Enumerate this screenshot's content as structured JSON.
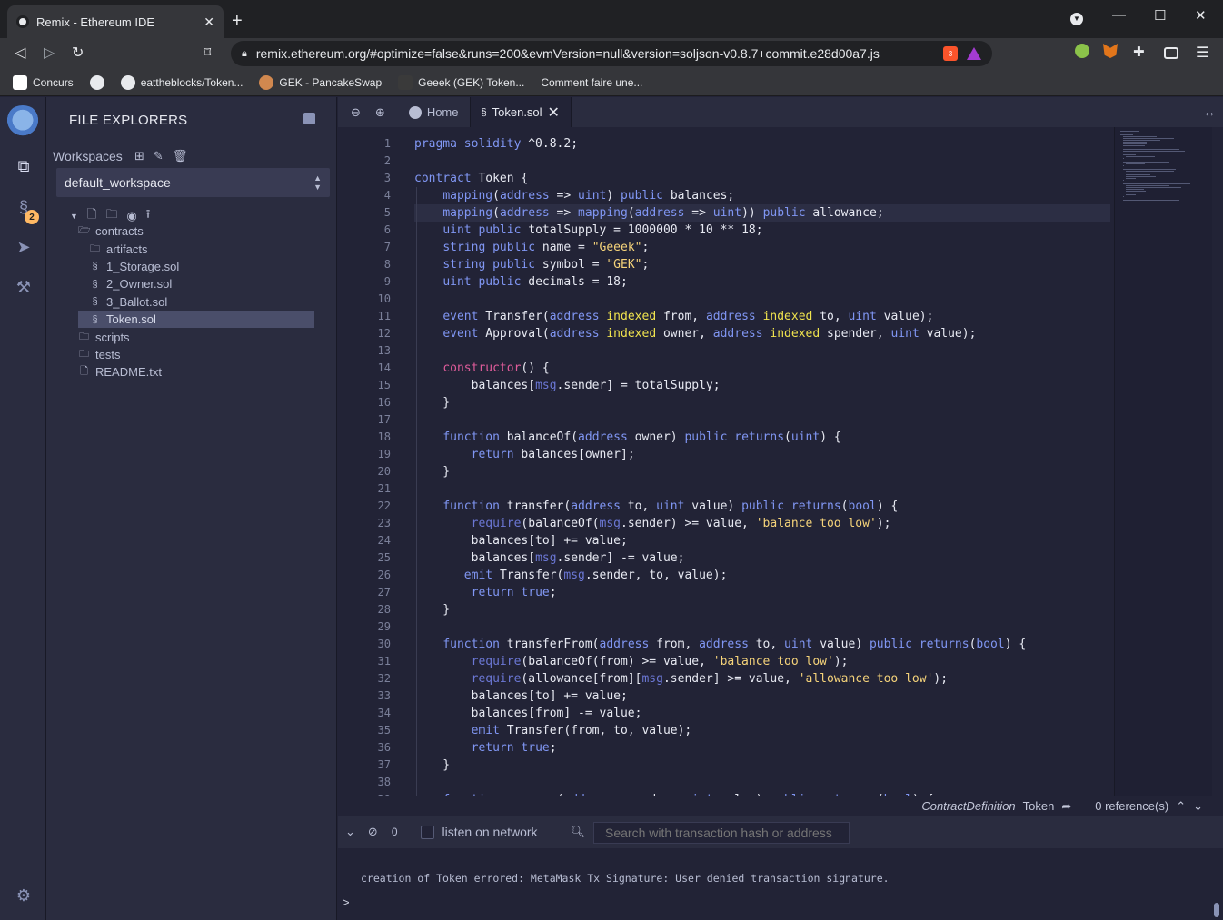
{
  "browser": {
    "tab_title": "Remix - Ethereum IDE",
    "url": "remix.ethereum.org/#optimize=false&runs=200&evmVersion=null&version=soljson-v0.8.7+commit.e28d00a7.js",
    "brave_count": "3",
    "bookmarks": [
      {
        "label": "Concurs"
      },
      {
        "label": ""
      },
      {
        "label": "eattheblocks/Token..."
      },
      {
        "label": "GEK - PancakeSwap"
      },
      {
        "label": "Geeek (GEK) Token..."
      },
      {
        "label": "Comment faire une..."
      }
    ]
  },
  "sidebar": {
    "badge_count": "2"
  },
  "file_explorer": {
    "title": "FILE EXPLORERS",
    "workspaces_label": "Workspaces",
    "workspace_selected": "default_workspace",
    "tree": [
      {
        "name": "contracts",
        "type": "folder-open",
        "depth": 0
      },
      {
        "name": "artifacts",
        "type": "folder",
        "depth": 1
      },
      {
        "name": "1_Storage.sol",
        "type": "sol",
        "depth": 1
      },
      {
        "name": "2_Owner.sol",
        "type": "sol",
        "depth": 1
      },
      {
        "name": "3_Ballot.sol",
        "type": "sol",
        "depth": 1
      },
      {
        "name": "Token.sol",
        "type": "sol",
        "depth": 1,
        "selected": true
      },
      {
        "name": "scripts",
        "type": "folder",
        "depth": 0
      },
      {
        "name": "tests",
        "type": "folder",
        "depth": 0
      },
      {
        "name": "README.txt",
        "type": "file",
        "depth": 0
      }
    ]
  },
  "editor": {
    "tabs": [
      {
        "label": "Home"
      },
      {
        "label": "Token.sol",
        "active": true
      }
    ],
    "code": [
      [
        [
          "k",
          "pragma solidity "
        ],
        [
          "n",
          "^0.8.2;"
        ]
      ],
      [],
      [
        [
          "k",
          "contract "
        ],
        [
          "n",
          "Token {"
        ]
      ],
      [
        [
          "n",
          "    "
        ],
        [
          "t",
          "mapping"
        ],
        [
          "n",
          "("
        ],
        [
          "t",
          "address"
        ],
        [
          "n",
          " => "
        ],
        [
          "t",
          "uint"
        ],
        [
          "n",
          ") "
        ],
        [
          "k",
          "public "
        ],
        [
          "n",
          "balances;"
        ]
      ],
      [
        [
          "n",
          "    "
        ],
        [
          "t",
          "mapping"
        ],
        [
          "n",
          "("
        ],
        [
          "t",
          "address"
        ],
        [
          "n",
          " => "
        ],
        [
          "t",
          "mapping"
        ],
        [
          "n",
          "("
        ],
        [
          "t",
          "address"
        ],
        [
          "n",
          " => "
        ],
        [
          "t",
          "uint"
        ],
        [
          "n",
          ")) "
        ],
        [
          "k",
          "public "
        ],
        [
          "n",
          "allowance;"
        ]
      ],
      [
        [
          "n",
          "    "
        ],
        [
          "t",
          "uint "
        ],
        [
          "k",
          "public "
        ],
        [
          "n",
          "totalSupply = "
        ],
        [
          "n",
          "1000000"
        ],
        [
          "n",
          " * "
        ],
        [
          "n",
          "10"
        ],
        [
          "n",
          " ** "
        ],
        [
          "n",
          "18;"
        ]
      ],
      [
        [
          "n",
          "    "
        ],
        [
          "t",
          "string "
        ],
        [
          "k",
          "public "
        ],
        [
          "n",
          "name = "
        ],
        [
          "s",
          "\"Geeek\""
        ],
        [
          "n",
          ";"
        ]
      ],
      [
        [
          "n",
          "    "
        ],
        [
          "t",
          "string "
        ],
        [
          "k",
          "public "
        ],
        [
          "n",
          "symbol = "
        ],
        [
          "s",
          "\"GEK\""
        ],
        [
          "n",
          ";"
        ]
      ],
      [
        [
          "n",
          "    "
        ],
        [
          "t",
          "uint "
        ],
        [
          "k",
          "public "
        ],
        [
          "n",
          "decimals = 18;"
        ]
      ],
      [],
      [
        [
          "n",
          "    "
        ],
        [
          "k",
          "event "
        ],
        [
          "n",
          "Transfer("
        ],
        [
          "t",
          "address "
        ],
        [
          "y",
          "indexed "
        ],
        [
          "n",
          "from, "
        ],
        [
          "t",
          "address "
        ],
        [
          "y",
          "indexed "
        ],
        [
          "n",
          "to, "
        ],
        [
          "t",
          "uint "
        ],
        [
          "n",
          "value);"
        ]
      ],
      [
        [
          "n",
          "    "
        ],
        [
          "k",
          "event "
        ],
        [
          "n",
          "Approval("
        ],
        [
          "t",
          "address "
        ],
        [
          "y",
          "indexed "
        ],
        [
          "n",
          "owner, "
        ],
        [
          "t",
          "address "
        ],
        [
          "y",
          "indexed "
        ],
        [
          "n",
          "spender, "
        ],
        [
          "t",
          "uint "
        ],
        [
          "n",
          "value);"
        ]
      ],
      [],
      [
        [
          "n",
          "    "
        ],
        [
          "p",
          "constructor"
        ],
        [
          "n",
          "() {"
        ]
      ],
      [
        [
          "n",
          "        balances["
        ],
        [
          "m",
          "msg"
        ],
        [
          "n",
          ".sender] = totalSupply;"
        ]
      ],
      [
        [
          "n",
          "    }"
        ]
      ],
      [],
      [
        [
          "n",
          "    "
        ],
        [
          "k",
          "function "
        ],
        [
          "n",
          "balanceOf("
        ],
        [
          "t",
          "address "
        ],
        [
          "n",
          "owner) "
        ],
        [
          "k",
          "public returns"
        ],
        [
          "n",
          "("
        ],
        [
          "t",
          "uint"
        ],
        [
          "n",
          ") {"
        ]
      ],
      [
        [
          "n",
          "        "
        ],
        [
          "k",
          "return "
        ],
        [
          "n",
          "balances[owner];"
        ]
      ],
      [
        [
          "n",
          "    }"
        ]
      ],
      [],
      [
        [
          "n",
          "    "
        ],
        [
          "k",
          "function "
        ],
        [
          "n",
          "transfer("
        ],
        [
          "t",
          "address "
        ],
        [
          "n",
          "to, "
        ],
        [
          "t",
          "uint "
        ],
        [
          "n",
          "value) "
        ],
        [
          "k",
          "public returns"
        ],
        [
          "n",
          "("
        ],
        [
          "t",
          "bool"
        ],
        [
          "n",
          ") {"
        ]
      ],
      [
        [
          "n",
          "        "
        ],
        [
          "m",
          "require"
        ],
        [
          "n",
          "(balanceOf("
        ],
        [
          "m",
          "msg"
        ],
        [
          "n",
          ".sender) >= value, "
        ],
        [
          "s",
          "'balance too low'"
        ],
        [
          "n",
          ");"
        ]
      ],
      [
        [
          "n",
          "        balances[to] += value;"
        ]
      ],
      [
        [
          "n",
          "        balances["
        ],
        [
          "m",
          "msg"
        ],
        [
          "n",
          ".sender] -= value;"
        ]
      ],
      [
        [
          "n",
          "       "
        ],
        [
          "k",
          "emit "
        ],
        [
          "n",
          "Transfer("
        ],
        [
          "m",
          "msg"
        ],
        [
          "n",
          ".sender, to, value);"
        ]
      ],
      [
        [
          "n",
          "        "
        ],
        [
          "k",
          "return true"
        ],
        [
          "n",
          ";"
        ]
      ],
      [
        [
          "n",
          "    }"
        ]
      ],
      [],
      [
        [
          "n",
          "    "
        ],
        [
          "k",
          "function "
        ],
        [
          "n",
          "transferFrom("
        ],
        [
          "t",
          "address "
        ],
        [
          "n",
          "from, "
        ],
        [
          "t",
          "address "
        ],
        [
          "n",
          "to, "
        ],
        [
          "t",
          "uint "
        ],
        [
          "n",
          "value) "
        ],
        [
          "k",
          "public returns"
        ],
        [
          "n",
          "("
        ],
        [
          "t",
          "bool"
        ],
        [
          "n",
          ") {"
        ]
      ],
      [
        [
          "n",
          "        "
        ],
        [
          "m",
          "require"
        ],
        [
          "n",
          "(balanceOf(from) >= value, "
        ],
        [
          "s",
          "'balance too low'"
        ],
        [
          "n",
          ");"
        ]
      ],
      [
        [
          "n",
          "        "
        ],
        [
          "m",
          "require"
        ],
        [
          "n",
          "(allowance[from]["
        ],
        [
          "m",
          "msg"
        ],
        [
          "n",
          ".sender] >= value, "
        ],
        [
          "s",
          "'allowance too low'"
        ],
        [
          "n",
          ");"
        ]
      ],
      [
        [
          "n",
          "        balances[to] += value;"
        ]
      ],
      [
        [
          "n",
          "        balances[from] -= value;"
        ]
      ],
      [
        [
          "n",
          "        "
        ],
        [
          "k",
          "emit "
        ],
        [
          "n",
          "Transfer(from, to, value);"
        ]
      ],
      [
        [
          "n",
          "        "
        ],
        [
          "k",
          "return true"
        ],
        [
          "n",
          ";"
        ]
      ],
      [
        [
          "n",
          "    }"
        ]
      ],
      [],
      [
        [
          "n",
          "    "
        ],
        [
          "k",
          "function "
        ],
        [
          "n",
          "approve("
        ],
        [
          "t",
          "address "
        ],
        [
          "n",
          "spender, "
        ],
        [
          "t",
          "uint "
        ],
        [
          "n",
          "value) "
        ],
        [
          "k",
          "public returns "
        ],
        [
          "n",
          "("
        ],
        [
          "t",
          "bool"
        ],
        [
          "n",
          ") {"
        ]
      ]
    ],
    "current_line": 5,
    "status_definition": "ContractDefinition",
    "status_name": "Token",
    "status_refs": "0 reference(s)"
  },
  "terminal": {
    "count": "0",
    "listen_label": "listen on network",
    "search_placeholder": "Search with transaction hash or address",
    "log_line": "creation of Token errored: MetaMask Tx Signature: User denied transaction signature.",
    "prompt": ">"
  }
}
